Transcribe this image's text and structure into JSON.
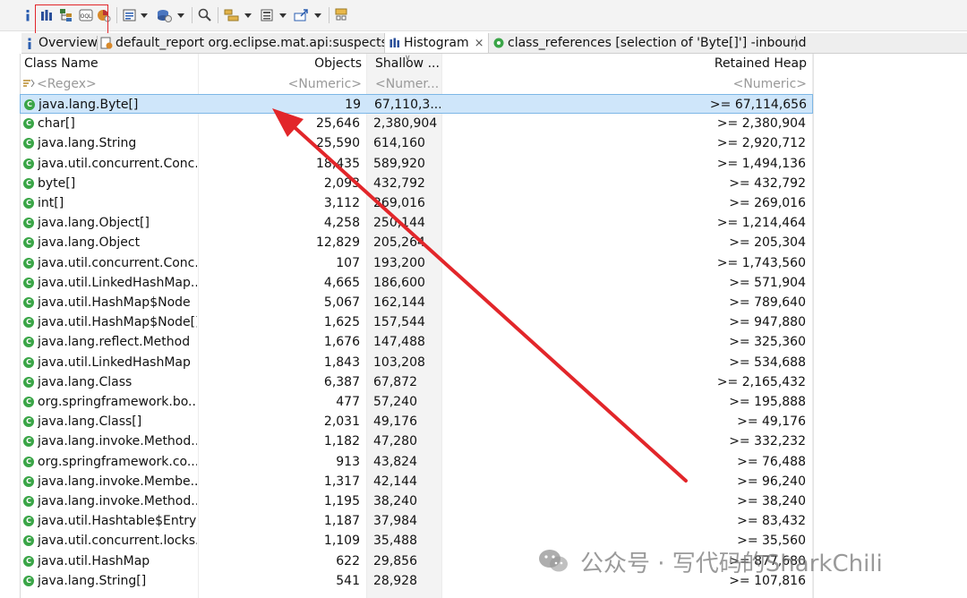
{
  "toolbar": {
    "buttons": [
      "info-icon",
      "histogram-icon",
      "dominator-tree-icon",
      "oql-icon",
      "top-consumers-icon",
      "query-browser-icon",
      "heap-dump-overview-icon",
      "find-object-icon",
      "group-icon",
      "calculate-icon",
      "export-icon",
      "pin-icon"
    ]
  },
  "tabs": [
    {
      "label": "Overview",
      "icon": "info-icon"
    },
    {
      "label": "default_report  org.eclipse.mat.api:suspects",
      "icon": "report-icon"
    },
    {
      "label": "Histogram",
      "icon": "histogram-icon",
      "active": true,
      "close": "×"
    },
    {
      "label": "class_references [selection of 'Byte[]'] -inbound",
      "icon": "class-references-icon"
    }
  ],
  "columns": {
    "class_name": "Class Name",
    "objects": "Objects",
    "shallow": "Shallow ...",
    "retained": "Retained Heap"
  },
  "filters": {
    "class_name": "<Regex>",
    "objects": "<Numeric>",
    "shallow": "<Numer...",
    "retained": "<Numeric>"
  },
  "rows": [
    {
      "name": "java.lang.Byte[]",
      "objects": "19",
      "shallow": "67,110,3...",
      "retained": ">= 67,114,656",
      "selected": true
    },
    {
      "name": "char[]",
      "objects": "25,646",
      "shallow": "2,380,904",
      "retained": ">= 2,380,904"
    },
    {
      "name": "java.lang.String",
      "objects": "25,590",
      "shallow": "614,160",
      "retained": ">= 2,920,712"
    },
    {
      "name": "java.util.concurrent.Conc...",
      "objects": "18,435",
      "shallow": "589,920",
      "retained": ">= 1,494,136"
    },
    {
      "name": "byte[]",
      "objects": "2,093",
      "shallow": "432,792",
      "retained": ">= 432,792"
    },
    {
      "name": "int[]",
      "objects": "3,112",
      "shallow": "269,016",
      "retained": ">= 269,016"
    },
    {
      "name": "java.lang.Object[]",
      "objects": "4,258",
      "shallow": "250,144",
      "retained": ">= 1,214,464"
    },
    {
      "name": "java.lang.Object",
      "objects": "12,829",
      "shallow": "205,264",
      "retained": ">= 205,304"
    },
    {
      "name": "java.util.concurrent.Conc...",
      "objects": "107",
      "shallow": "193,200",
      "retained": ">= 1,743,560"
    },
    {
      "name": "java.util.LinkedHashMap...",
      "objects": "4,665",
      "shallow": "186,600",
      "retained": ">= 571,904"
    },
    {
      "name": "java.util.HashMap$Node",
      "objects": "5,067",
      "shallow": "162,144",
      "retained": ">= 789,640"
    },
    {
      "name": "java.util.HashMap$Node[]",
      "objects": "1,625",
      "shallow": "157,544",
      "retained": ">= 947,880"
    },
    {
      "name": "java.lang.reflect.Method",
      "objects": "1,676",
      "shallow": "147,488",
      "retained": ">= 325,360"
    },
    {
      "name": "java.util.LinkedHashMap",
      "objects": "1,843",
      "shallow": "103,208",
      "retained": ">= 534,688"
    },
    {
      "name": "java.lang.Class",
      "objects": "6,387",
      "shallow": "67,872",
      "retained": ">= 2,165,432"
    },
    {
      "name": "org.springframework.bo...",
      "objects": "477",
      "shallow": "57,240",
      "retained": ">= 195,888"
    },
    {
      "name": "java.lang.Class[]",
      "objects": "2,031",
      "shallow": "49,176",
      "retained": ">= 49,176"
    },
    {
      "name": "java.lang.invoke.Method...",
      "objects": "1,182",
      "shallow": "47,280",
      "retained": ">= 332,232"
    },
    {
      "name": "org.springframework.co...",
      "objects": "913",
      "shallow": "43,824",
      "retained": ">= 76,488"
    },
    {
      "name": "java.lang.invoke.Membe...",
      "objects": "1,317",
      "shallow": "42,144",
      "retained": ">= 96,240"
    },
    {
      "name": "java.lang.invoke.Method...",
      "objects": "1,195",
      "shallow": "38,240",
      "retained": ">= 38,240"
    },
    {
      "name": "java.util.Hashtable$Entry",
      "objects": "1,187",
      "shallow": "37,984",
      "retained": ">= 83,432"
    },
    {
      "name": "java.util.concurrent.locks...",
      "objects": "1,109",
      "shallow": "35,488",
      "retained": ">= 35,560"
    },
    {
      "name": "java.util.HashMap",
      "objects": "622",
      "shallow": "29,856",
      "retained": ">= 877,680"
    },
    {
      "name": "java.lang.String[]",
      "objects": "541",
      "shallow": "28,928",
      "retained": ">= 107,816"
    }
  ],
  "watermark": "公众号 · 写代码的SharkChili",
  "colors": {
    "annotation_red": "#e2262a",
    "selection": "#cfe6fa",
    "class_icon": "#3aa547"
  }
}
